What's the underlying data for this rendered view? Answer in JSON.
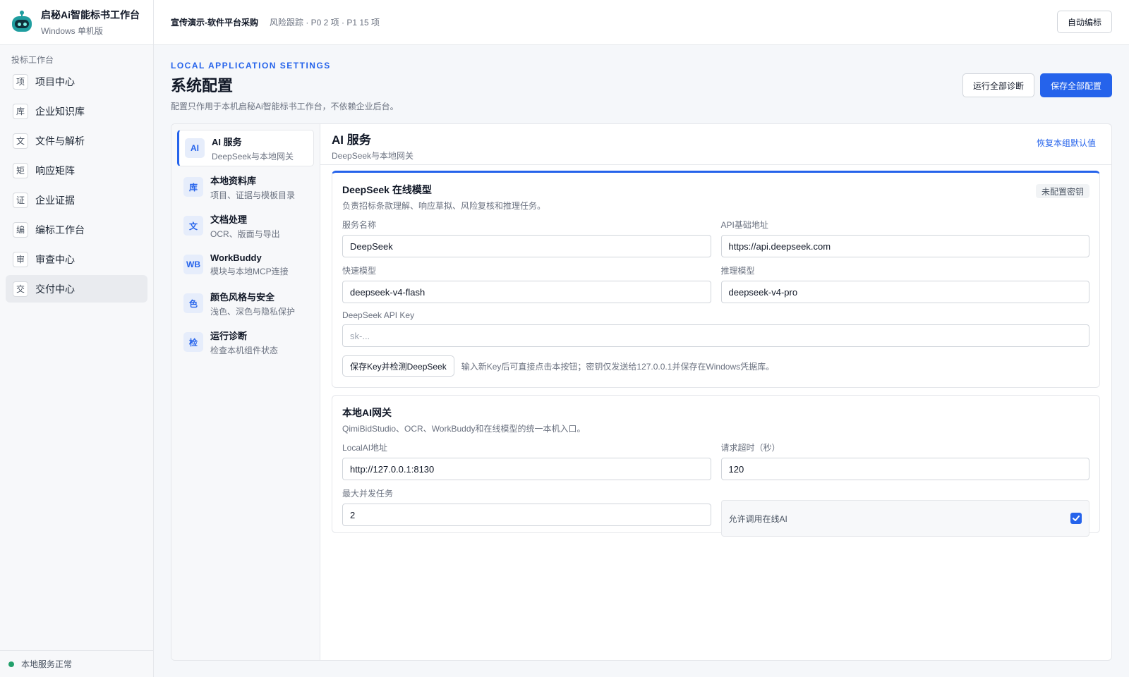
{
  "app": {
    "title": "启秘Ai智能标书工作台",
    "subtitle": "Windows 单机版"
  },
  "sidebar": {
    "group_label": "投标工作台",
    "items": [
      {
        "icon": "项",
        "label": "项目中心"
      },
      {
        "icon": "库",
        "label": "企业知识库"
      },
      {
        "icon": "文",
        "label": "文件与解析"
      },
      {
        "icon": "矩",
        "label": "响应矩阵"
      },
      {
        "icon": "证",
        "label": "企业证据"
      },
      {
        "icon": "编",
        "label": "编标工作台"
      },
      {
        "icon": "审",
        "label": "审查中心"
      },
      {
        "icon": "交",
        "label": "交付中心"
      }
    ],
    "active_index": 7,
    "status": "本地服务正常",
    "status_color": "#22a06b"
  },
  "topbar": {
    "project": "宣传演示-软件平台采购",
    "risk": "风险跟踪 · P0 2 项 · P1 15 项",
    "auto_button": "自动编标"
  },
  "page": {
    "eyebrow": "LOCAL APPLICATION SETTINGS",
    "title": "系统配置",
    "description": "配置只作用于本机启秘Ai智能标书工作台，不依赖企业后台。",
    "diagnose_button": "运行全部诊断",
    "save_button": "保存全部配置"
  },
  "categories": [
    {
      "icon": "AI",
      "title": "AI 服务",
      "sub": "DeepSeek与本地网关"
    },
    {
      "icon": "库",
      "title": "本地资料库",
      "sub": "项目、证据与模板目录"
    },
    {
      "icon": "文",
      "title": "文档处理",
      "sub": "OCR、版面与导出"
    },
    {
      "icon": "WB",
      "title": "WorkBuddy",
      "sub": "模块与本地MCP连接"
    },
    {
      "icon": "色",
      "title": "颜色风格与安全",
      "sub": "浅色、深色与隐私保护"
    },
    {
      "icon": "检",
      "title": "运行诊断",
      "sub": "检查本机组件状态"
    }
  ],
  "section": {
    "title": "AI 服务",
    "subtitle": "DeepSeek与本地网关",
    "restore": "恢复本组默认值"
  },
  "deepseek": {
    "title": "DeepSeek 在线模型",
    "subtitle": "负责招标条款理解、响应草拟、风险复核和推理任务。",
    "badge": "未配置密钥",
    "service_name_label": "服务名称",
    "service_name": "DeepSeek",
    "api_base_label": "API基础地址",
    "api_base": "https://api.deepseek.com",
    "fast_model_label": "快速模型",
    "fast_model": "deepseek-v4-flash",
    "reason_model_label": "推理模型",
    "reason_model": "deepseek-v4-pro",
    "api_key_label": "DeepSeek API Key",
    "api_key_placeholder": "sk-...",
    "save_check_button": "保存Key并检测DeepSeek",
    "hint": "输入新Key后可直接点击本按钮；密钥仅发送给127.0.0.1并保存在Windows凭据库。"
  },
  "gateway": {
    "title": "本地AI网关",
    "subtitle": "QimiBidStudio、OCR、WorkBuddy和在线模型的统一本机入口。",
    "address_label": "LocalAI地址",
    "address": "http://127.0.0.1:8130",
    "timeout_label": "请求超时（秒）",
    "timeout": "120",
    "concurrency_label": "最大并发任务",
    "concurrency": "2",
    "allow_online_label": "允许调用在线AI",
    "allow_online": true
  }
}
